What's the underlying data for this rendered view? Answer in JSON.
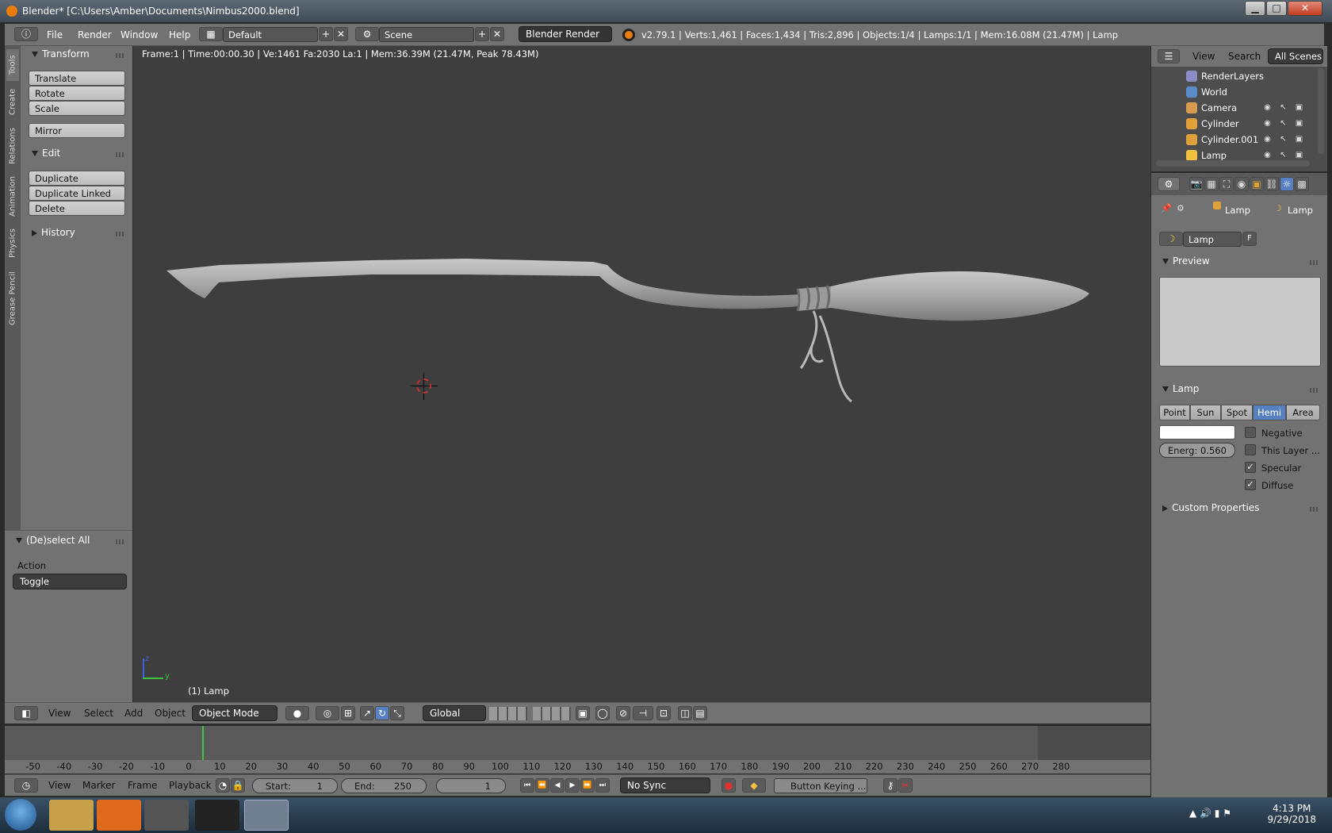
{
  "window": {
    "title": "Blender* [C:\\Users\\Amber\\Documents\\Nimbus2000.blend]",
    "min": "▁",
    "max": "□",
    "close": "✕"
  },
  "menubar": {
    "menus": [
      "File",
      "Render",
      "Window",
      "Help"
    ],
    "layout": "Default",
    "scene": "Scene",
    "engine": "Blender Render",
    "stats": "v2.79.1 | Verts:1,461 | Faces:1,434 | Tris:2,896 | Objects:1/4 | Lamps:1/1 | Mem:16.08M (21.47M) | Lamp",
    "plus": "+",
    "x": "✕"
  },
  "toolshelf": {
    "tabs": [
      "Tools",
      "Create",
      "Relations",
      "Animation",
      "Physics",
      "Grease Pencil"
    ],
    "transform": {
      "header": "Transform",
      "buttons": [
        "Translate",
        "Rotate",
        "Scale",
        "Mirror"
      ]
    },
    "edit": {
      "header": "Edit",
      "buttons": [
        "Duplicate",
        "Duplicate Linked",
        "Delete"
      ]
    },
    "history": {
      "header": "History"
    },
    "operator": {
      "header": "(De)select All",
      "action_label": "Action",
      "action_value": "Toggle"
    }
  },
  "viewport": {
    "info": "Frame:1 | Time:00:00.30 | Ve:1461 Fa:2030 La:1 | Mem:36.39M (21.47M, Peak 78.43M)",
    "object_label": "(1) Lamp",
    "axis_z": "z",
    "axis_y": "y"
  },
  "viewport_header": {
    "menus": [
      "View",
      "Select",
      "Add",
      "Object"
    ],
    "mode": "Object Mode",
    "orientation": "Global"
  },
  "timeline": {
    "ticks": [
      "-50",
      "-40",
      "-30",
      "-20",
      "-10",
      "0",
      "10",
      "20",
      "30",
      "40",
      "50",
      "60",
      "70",
      "80",
      "90",
      "100",
      "110",
      "120",
      "130",
      "140",
      "150",
      "160",
      "170",
      "180",
      "190",
      "200",
      "210",
      "220",
      "230",
      "240",
      "250",
      "260",
      "270",
      "280"
    ],
    "current_frame_marker": 1,
    "menus": [
      "View",
      "Marker",
      "Frame",
      "Playback"
    ],
    "start_label": "Start:",
    "start": "1",
    "end_label": "End:",
    "end": "250",
    "current": "1",
    "sync": "No Sync",
    "keying": "Button Keying ..."
  },
  "outliner": {
    "menus": [
      "View",
      "Search"
    ],
    "filter": "All Scenes",
    "items": [
      {
        "name": "RenderLayers",
        "color": "#8c8cc8"
      },
      {
        "name": "World",
        "color": "#5a8cc8"
      },
      {
        "name": "Camera",
        "color": "#d89a4c"
      },
      {
        "name": "Cylinder",
        "color": "#e0a03c"
      },
      {
        "name": "Cylinder.001",
        "color": "#e0a03c"
      },
      {
        "name": "Lamp",
        "color": "#f0c040"
      }
    ]
  },
  "properties": {
    "breadcrumb": [
      "Lamp",
      "Lamp"
    ],
    "datablock": "Lamp",
    "fake_user": "F",
    "preview_header": "Preview",
    "lamp_header": "Lamp",
    "lamp_types": [
      "Point",
      "Sun",
      "Spot",
      "Hemi",
      "Area"
    ],
    "active_type": "Hemi",
    "energy": "Energ: 0.560",
    "options": [
      {
        "label": "Negative",
        "checked": false
      },
      {
        "label": "This Layer ...",
        "checked": false
      },
      {
        "label": "Specular",
        "checked": true
      },
      {
        "label": "Diffuse",
        "checked": true
      }
    ],
    "custom_props": "Custom Properties"
  },
  "taskbar": {
    "time": "4:13 PM",
    "date": "9/29/2018"
  },
  "colors": {
    "accent": "#5680c2",
    "orange": "#e87d0d",
    "timeline_cursor": "#3ec13e"
  }
}
